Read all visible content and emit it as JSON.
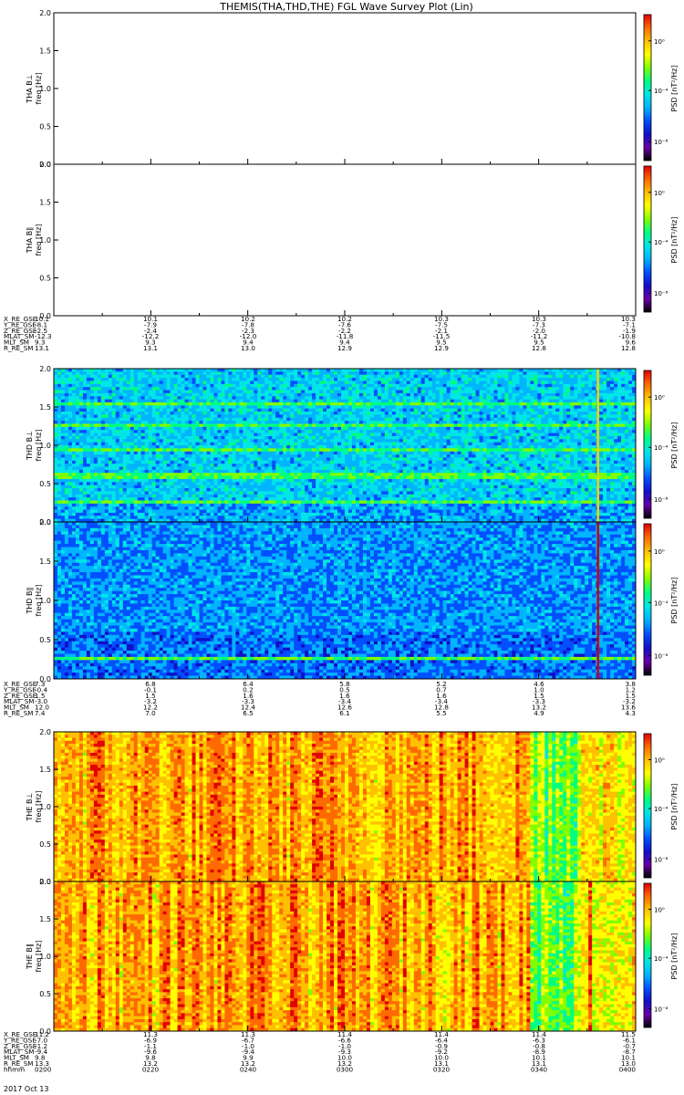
{
  "title": "THEMIS(THA,THD,THE) FGL Wave Survey Plot (Lin)",
  "colorbar_label": "PSD [nT²/Hz]",
  "date_label": "2017 Oct 13",
  "freq_unit_label": "freq [Hz]",
  "colormap": [
    "#000000",
    "#6a00a8",
    "#1010c8",
    "#0050ff",
    "#00b4ff",
    "#00e6e6",
    "#00ff80",
    "#80ff00",
    "#ffff00",
    "#ffc000",
    "#ff6a00",
    "#e00000"
  ],
  "chart_data": [
    {
      "type": "heatmap",
      "probe": "THA",
      "ylabel": "THA B⊥",
      "ylim": [
        0.0,
        2.0
      ],
      "yticks": [
        "0.0",
        "0.5",
        "1.0",
        "1.5",
        "2.0"
      ],
      "colorbar_ticks": [
        "10⁰",
        "10⁻⁴",
        "10⁻⁸"
      ],
      "data_present": false
    },
    {
      "type": "heatmap",
      "probe": "THA",
      "ylabel": "THA B∥",
      "ylim": [
        0.0,
        2.0
      ],
      "yticks": [
        "0.0",
        "0.5",
        "1.0",
        "1.5",
        "2.0"
      ],
      "colorbar_ticks": [
        "10⁰",
        "10⁻⁴",
        "10⁻⁸"
      ],
      "data_present": false
    },
    {
      "type": "table",
      "probe": "THA",
      "rows": [
        {
          "label": "X_RE_GSE",
          "values": [
            "10.1",
            "10.1",
            "10.2",
            "10.2",
            "10.3",
            "10.3",
            "10.3"
          ]
        },
        {
          "label": "Y_RE_GSE",
          "values": [
            "-8.1",
            "-7.9",
            "-7.8",
            "-7.6",
            "-7.5",
            "-7.3",
            "-7.1"
          ]
        },
        {
          "label": "Z_RE_GSE",
          "values": [
            "-2.5",
            "-2.4",
            "-2.3",
            "-2.2",
            "-2.1",
            "-2.0",
            "-1.9"
          ]
        },
        {
          "label": "MLAT_SM",
          "values": [
            "-12.3",
            "-12.2",
            "-12.0",
            "-11.8",
            "-11.5",
            "-11.2",
            "-10.8"
          ]
        },
        {
          "label": "MLT_SM",
          "values": [
            "9.3",
            "9.3",
            "9.4",
            "9.4",
            "9.5",
            "9.5",
            "9.6"
          ]
        },
        {
          "label": "R_RE_SM",
          "values": [
            "13.1",
            "13.1",
            "13.0",
            "12.9",
            "12.9",
            "12.8",
            "12.8"
          ]
        }
      ]
    },
    {
      "type": "heatmap",
      "probe": "THD",
      "ylabel": "THD B⊥",
      "ylim": [
        0.0,
        2.0
      ],
      "yticks": [
        "0.0",
        "0.5",
        "1.0",
        "1.5",
        "2.0"
      ],
      "colorbar_ticks": [
        "10⁰",
        "10⁻⁴",
        "10⁻⁸"
      ],
      "data_present": true,
      "background_level": "blue-cyan",
      "enhanced_bands_hz": [
        1.55,
        1.25,
        0.93,
        0.6,
        0.27
      ],
      "vertical_feature_time": "0352"
    },
    {
      "type": "heatmap",
      "probe": "THD",
      "ylabel": "THD B∥",
      "ylim": [
        0.0,
        2.0
      ],
      "yticks": [
        "0.0",
        "0.5",
        "1.0",
        "1.5",
        "2.0"
      ],
      "colorbar_ticks": [
        "10⁰",
        "10⁻⁴",
        "10⁻⁸"
      ],
      "data_present": true,
      "background_level": "dark blue",
      "enhanced_bands_hz": [
        0.27
      ],
      "vertical_feature_time": "0352"
    },
    {
      "type": "table",
      "probe": "THD",
      "rows": [
        {
          "label": "X_RE_GSE",
          "values": [
            "7.3",
            "6.8",
            "6.4",
            "5.8",
            "5.2",
            "4.6",
            "3.8"
          ]
        },
        {
          "label": "Y_RE_GSE",
          "values": [
            "-0.4",
            "-0.1",
            "0.2",
            "0.5",
            "0.7",
            "1.0",
            "1.2"
          ]
        },
        {
          "label": "Z_RE_GSE",
          "values": [
            "1.5",
            "1.5",
            "1.6",
            "1.6",
            "1.6",
            "1.5",
            "1.5"
          ]
        },
        {
          "label": "MLAT_SM",
          "values": [
            "-3.0",
            "-3.2",
            "-3.3",
            "-3.4",
            "-3.4",
            "-3.3",
            "-3.2"
          ]
        },
        {
          "label": "MLT_SM",
          "values": [
            "12.0",
            "12.2",
            "12.4",
            "12.6",
            "12.8",
            "13.2",
            "13.6"
          ]
        },
        {
          "label": "R_RE_SM",
          "values": [
            "7.4",
            "7.0",
            "6.5",
            "6.1",
            "5.5",
            "4.9",
            "4.3"
          ]
        }
      ]
    },
    {
      "type": "heatmap",
      "probe": "THE",
      "ylabel": "THE B⊥",
      "ylim": [
        0.0,
        2.0
      ],
      "yticks": [
        "0.0",
        "0.5",
        "1.0",
        "1.5",
        "2.0"
      ],
      "colorbar_ticks": [
        "10⁰",
        "10⁻⁴",
        "10⁻⁸"
      ],
      "data_present": true,
      "background_level": "yellow-orange-red"
    },
    {
      "type": "heatmap",
      "probe": "THE",
      "ylabel": "THE B∥",
      "ylim": [
        0.0,
        2.0
      ],
      "yticks": [
        "0.0",
        "0.5",
        "1.0",
        "1.5",
        "2.0"
      ],
      "colorbar_ticks": [
        "10⁰",
        "10⁻⁴",
        "10⁻⁸"
      ],
      "data_present": true,
      "background_level": "yellow-orange-red"
    },
    {
      "type": "table",
      "probe": "THE",
      "rows": [
        {
          "label": "X_RE_GSE",
          "values": [
            "11.2",
            "11.3",
            "11.3",
            "11.4",
            "11.4",
            "11.4",
            "11.5"
          ]
        },
        {
          "label": "Y_RE_GSE",
          "values": [
            "-7.0",
            "-6.9",
            "-6.7",
            "-6.6",
            "-6.4",
            "-6.3",
            "-6.1"
          ]
        },
        {
          "label": "Z_RE_GSE",
          "values": [
            "-1.2",
            "-1.1",
            "-1.0",
            "-1.0",
            "-0.9",
            "-0.8",
            "-0.7"
          ]
        },
        {
          "label": "MLAT_SM",
          "values": [
            "-9.4",
            "-9.6",
            "-9.4",
            "-9.3",
            "-9.2",
            "-8.9",
            "-8.7"
          ]
        },
        {
          "label": "MLT_SM",
          "values": [
            "9.8",
            "9.8",
            "9.9",
            "10.0",
            "10.0",
            "10.1",
            "10.1"
          ]
        },
        {
          "label": "R_RE_SM",
          "values": [
            "13.3",
            "13.2",
            "13.2",
            "13.2",
            "13.1",
            "13.1",
            "13.0"
          ]
        },
        {
          "label": "hhmm",
          "values": [
            "0200",
            "0220",
            "0240",
            "0300",
            "0320",
            "0340",
            "0400"
          ]
        }
      ]
    }
  ]
}
